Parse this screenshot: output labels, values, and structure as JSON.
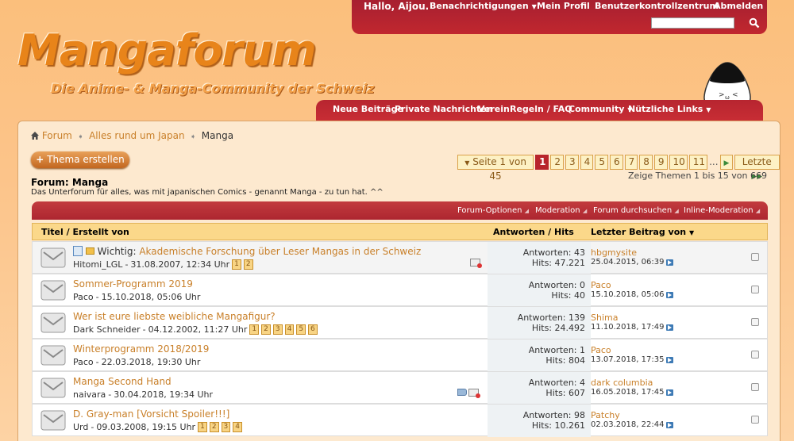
{
  "userbar": {
    "greeting": "Hallo, Aijou.",
    "links": [
      {
        "label": "Benachrichtigungen",
        "dropdown": true
      },
      {
        "label": "Mein Profil",
        "dropdown": false
      },
      {
        "label": "Benutzerkontrollzentrum",
        "dropdown": false
      },
      {
        "label": "Abmelden",
        "dropdown": false
      }
    ],
    "search_placeholder": ""
  },
  "logo": {
    "title": "Mangaforum",
    "subtitle": "Die Anime- & Manga-Community der Schweiz"
  },
  "navbar": {
    "items": [
      {
        "label": "Neue Beiträge",
        "dropdown": false
      },
      {
        "label": "Private Nachrichten",
        "dropdown": false
      },
      {
        "label": "Verein",
        "dropdown": false
      },
      {
        "label": "Regeln / FAQ",
        "dropdown": false
      },
      {
        "label": "Community",
        "dropdown": true
      },
      {
        "label": "Nützliche Links",
        "dropdown": true
      }
    ]
  },
  "breadcrumb": {
    "items": [
      "Forum",
      "Alles rund um Japan"
    ],
    "current": "Manga"
  },
  "new_thread_button": "Thema erstellen",
  "pagination": {
    "label": "Seite 1 von 45",
    "current": "1",
    "pages": [
      "2",
      "3",
      "4",
      "5",
      "6",
      "7",
      "8",
      "9",
      "10",
      "11"
    ],
    "dots": "...",
    "last": "Letzte"
  },
  "showing": "Zeige Themen 1 bis 15 von 669",
  "forum": {
    "title": "Forum: Manga",
    "description": "Das Unterforum für alles, was mit japanischen Comics - genannt Manga - zu tun hat. ^^"
  },
  "options": [
    "Forum-Optionen",
    "Moderation",
    "Forum durchsuchen",
    "Inline-Moderation"
  ],
  "columns": {
    "title": "Titel",
    "sep1": "/",
    "created_by": "Erstellt von",
    "answers": "Antworten",
    "sep2": "/",
    "hits": "Hits",
    "last_post": "Letzter Beitrag von"
  },
  "threads": [
    {
      "prefix": "Wichtig:",
      "title": "Akademische Forschung über Leser Mangas in der Schweiz",
      "author": "Hitomi_LGL",
      "date": "31.08.2007, 12:34 Uhr",
      "pages": [
        "1",
        "2"
      ],
      "answers": "Antworten: 43",
      "hits": "Hits: 47.221",
      "last_user": "hbgmysite",
      "last_date": "25.04.2015, 06:39",
      "sticky": true
    },
    {
      "prefix": "",
      "title": "Sommer-Programm 2019",
      "author": "Paco",
      "date": "15.10.2018, 05:06 Uhr",
      "pages": [],
      "answers": "Antworten: 0",
      "hits": "Hits: 40",
      "last_user": "Paco",
      "last_date": "15.10.2018, 05:06",
      "sticky": false
    },
    {
      "prefix": "",
      "title": "Wer ist eure liebste weibliche Mangafigur?",
      "author": "Dark Schneider",
      "date": "04.12.2002, 11:27 Uhr",
      "pages": [
        "1",
        "2",
        "3",
        "4",
        "5",
        "6"
      ],
      "answers": "Antworten: 139",
      "hits": "Hits: 24.492",
      "last_user": "Shima",
      "last_date": "11.10.2018, 17:49",
      "sticky": false
    },
    {
      "prefix": "",
      "title": "Winterprogramm 2018/2019",
      "author": "Paco",
      "date": "22.03.2018, 19:30 Uhr",
      "pages": [],
      "answers": "Antworten: 1",
      "hits": "Hits: 804",
      "last_user": "Paco",
      "last_date": "13.07.2018, 17:35",
      "sticky": false
    },
    {
      "prefix": "",
      "title": "Manga Second Hand",
      "author": "naivara",
      "date": "30.04.2018, 19:34 Uhr",
      "pages": [],
      "answers": "Antworten: 4",
      "hits": "Hits: 607",
      "last_user": "dark columbia",
      "last_date": "16.05.2018, 17:45",
      "sticky": false
    },
    {
      "prefix": "",
      "title": "D. Gray-man [Vorsicht Spoiler!!!]",
      "author": "Urd",
      "date": "09.03.2008, 19:15 Uhr",
      "pages": [
        "1",
        "2",
        "3",
        "4"
      ],
      "answers": "Antworten: 98",
      "hits": "Hits: 10.261",
      "last_user": "Patchy",
      "last_date": "02.03.2018, 22:44",
      "sticky": false
    }
  ],
  "colors": {
    "accent_red": "#b8242c",
    "link_orange": "#c9802a",
    "background_orange": "#fbbf7c"
  }
}
